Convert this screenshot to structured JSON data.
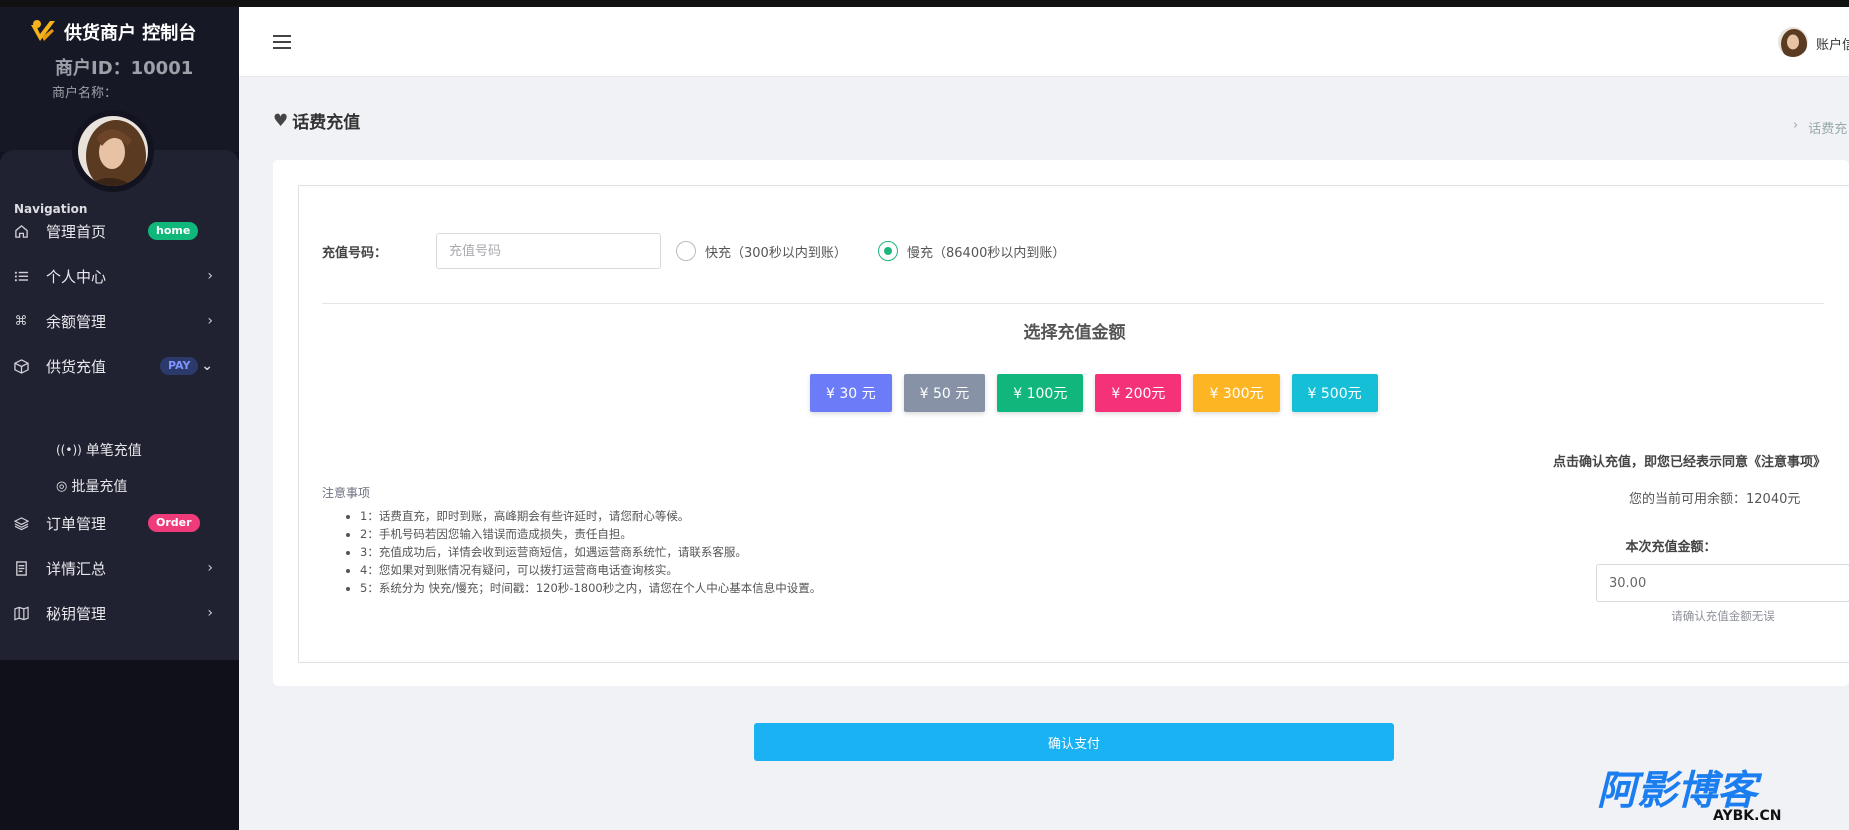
{
  "app": {
    "brand": "供货商户 控制台",
    "merchant_id": "商户ID：10001",
    "merchant_name": "商户名称："
  },
  "sidebar": {
    "nav_title": "Navigation",
    "items": [
      {
        "label": "管理首页",
        "icon": "home-icon",
        "badge": "home"
      },
      {
        "label": "个人中心",
        "icon": "list-icon",
        "chevron": "›"
      },
      {
        "label": "余额管理",
        "icon": "command-icon",
        "chevron": "›"
      },
      {
        "label": "供货充值",
        "icon": "box-icon",
        "badge": "PAY",
        "chevron": "⌄"
      },
      {
        "label": "订单管理",
        "icon": "layers-icon",
        "badge": "Order"
      },
      {
        "label": "详情汇总",
        "icon": "document-icon",
        "chevron": "›"
      },
      {
        "label": "秘钥管理",
        "icon": "map-icon",
        "chevron": "›"
      }
    ],
    "sub_items": [
      {
        "label": "单笔充值",
        "icon": "broadcast-icon"
      },
      {
        "label": "批量充值",
        "icon": "chrome-icon"
      }
    ]
  },
  "topbar": {
    "user_label": "账户信"
  },
  "page": {
    "title": "话费充值",
    "breadcrumb_sep": "›",
    "breadcrumb": "话费充"
  },
  "form": {
    "number_label": "充值号码：",
    "number_placeholder": "充值号码",
    "radio_fast": "快充（300秒以内到账）",
    "radio_slow": "慢充（86400秒以内到账）",
    "selected_mode": "slow",
    "amount_section_title": "选择充值金额",
    "amounts": [
      {
        "label": "¥ 30 元",
        "color": "#6c7bf8"
      },
      {
        "label": "¥ 50 元",
        "color": "#8792a7"
      },
      {
        "label": "¥ 100元",
        "color": "#10b67b"
      },
      {
        "label": "¥ 200元",
        "color": "#f5317a"
      },
      {
        "label": "¥ 300元",
        "color": "#fdb523"
      },
      {
        "label": "¥ 500元",
        "color": "#15c0d6"
      }
    ],
    "notes_title": "注意事项",
    "notes": [
      "1：话费直充，即时到账，高峰期会有些许延时，请您耐心等候。",
      "2：手机号码若因您输入错误而造成损失，责任自担。",
      "3：充值成功后，详情会收到运营商短信，如遇运营商系统忙，请联系客服。",
      "4：您如果对到账情况有疑问，可以拨打运营商电话查询核实。",
      "5：系统分为 快充/慢充；时间戳：120秒-1800秒之内，请您在个人中心基本信息中设置。"
    ],
    "agree_text": "点击确认充值，即您已经表示同意《注意事项》",
    "balance_text": "您的当前可用余额：12040元",
    "amount_label": "本次充值金额：",
    "amount_value": "30.00",
    "amount_hint": "请确认充值金额无误",
    "confirm_label": "确认支付"
  },
  "watermark": {
    "main": "阿影博客",
    "sub": "AYBK.CN"
  }
}
